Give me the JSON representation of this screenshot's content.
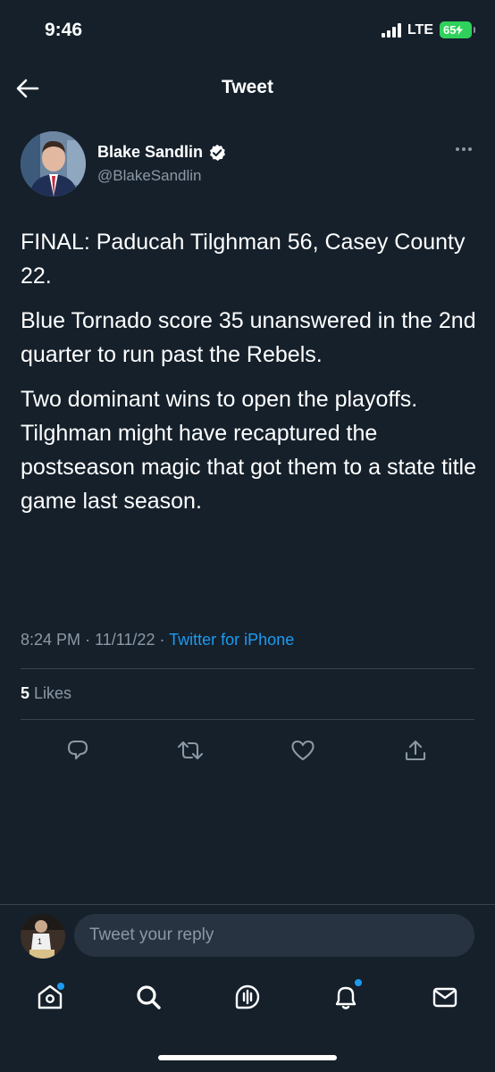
{
  "status_bar": {
    "time": "9:46",
    "network": "LTE",
    "battery": "65"
  },
  "header": {
    "title": "Tweet",
    "back_icon": "arrow-left-icon"
  },
  "tweet": {
    "author_name": "Blake Sandlin",
    "author_handle": "@BlakeSandlin",
    "verified": true,
    "paragraphs": [
      "FINAL: Paducah Tilghman 56, Casey County 22.",
      "Blue Tornado score 35 unanswered in the 2nd quarter to run past the Rebels.",
      "Two dominant wins to open the playoffs. Tilghman might have recaptured the postseason magic that got them to a state title game last season."
    ],
    "time": "8:24 PM",
    "date": "11/11/22",
    "source": "Twitter for iPhone",
    "likes_count": "5",
    "likes_label": "Likes"
  },
  "actions": {
    "reply_icon": "reply-icon",
    "retweet_icon": "retweet-icon",
    "like_icon": "heart-icon",
    "share_icon": "share-icon"
  },
  "reply": {
    "placeholder": "Tweet your reply"
  },
  "tab_bar": {
    "items": [
      "home-icon",
      "search-icon",
      "spaces-icon",
      "notifications-icon",
      "messages-icon"
    ]
  },
  "colors": {
    "background": "#15202b",
    "accent": "#1d9bf0",
    "muted_text": "#8b98a5",
    "divider": "#38444d",
    "battery": "#2fd15a"
  }
}
